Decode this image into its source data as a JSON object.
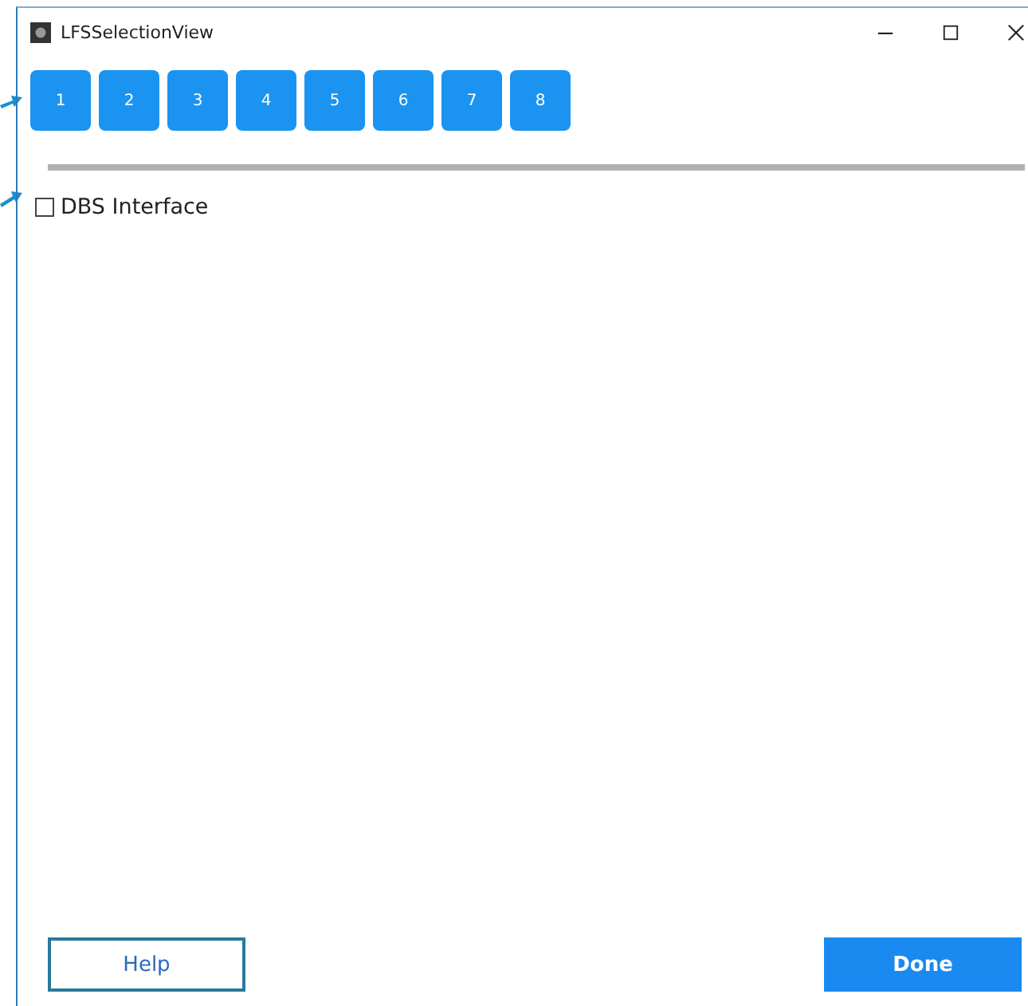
{
  "window": {
    "title": "LFSSelectionView"
  },
  "tabs": [
    "1",
    "2",
    "3",
    "4",
    "5",
    "6",
    "7",
    "8"
  ],
  "options": [
    {
      "label": "DBS Interface",
      "checked": false
    }
  ],
  "buttons": {
    "help": "Help",
    "done": "Done"
  }
}
